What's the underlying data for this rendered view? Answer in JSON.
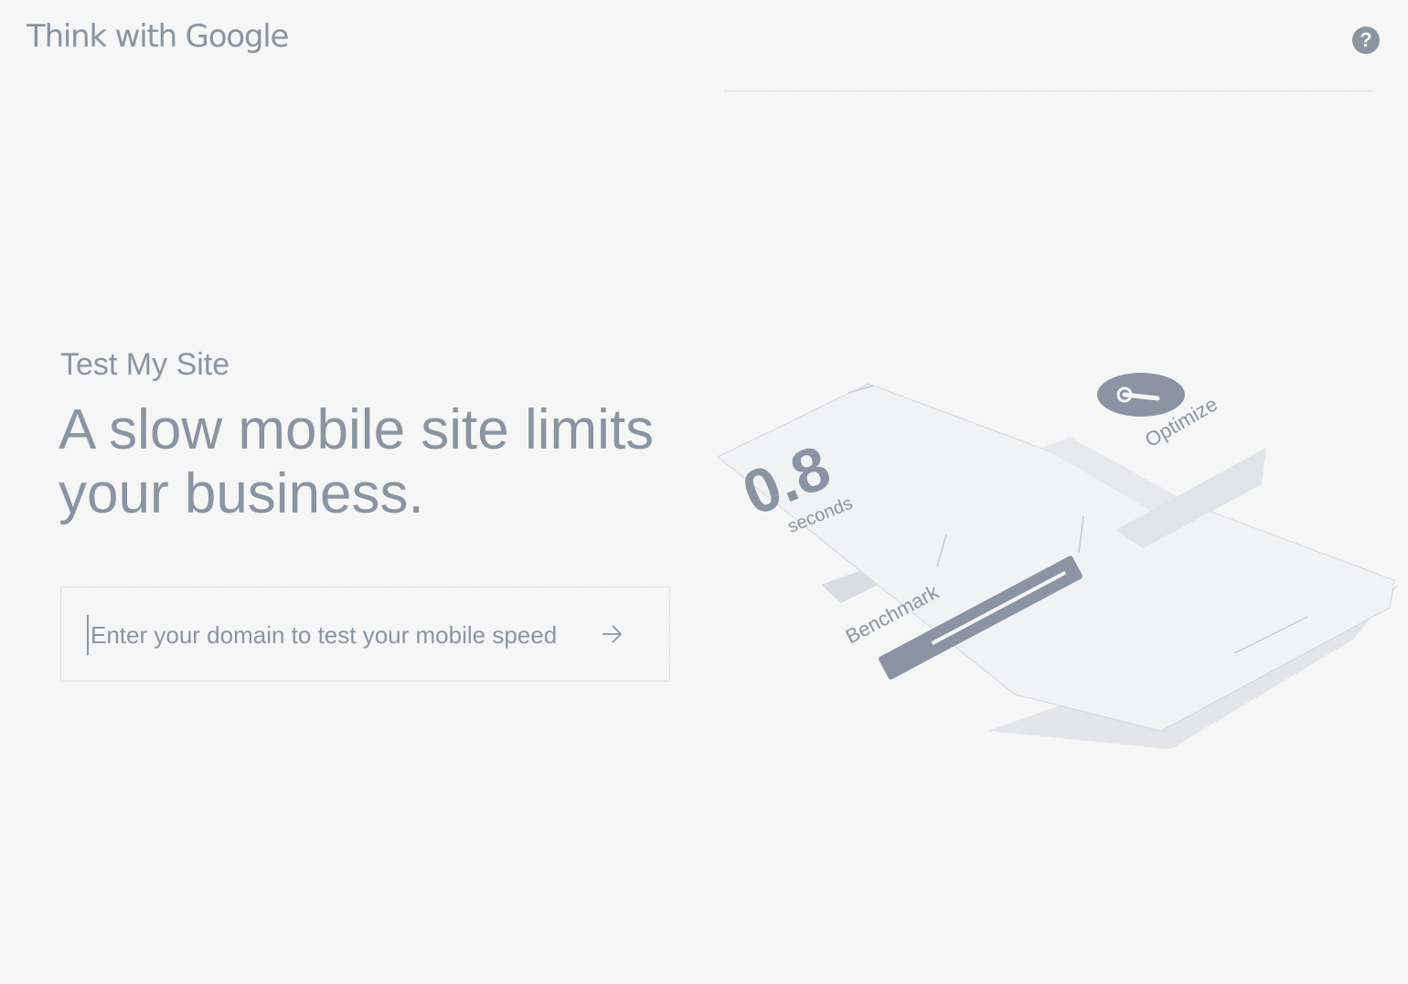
{
  "header": {
    "logo_text": "Think with Google",
    "help_icon": "question-circle-icon",
    "help_glyph": "?"
  },
  "hero": {
    "eyebrow": "Test My Site",
    "headline": "A slow mobile site limits your business."
  },
  "search": {
    "placeholder": "Enter your domain to test your mobile speed",
    "value": "",
    "submit_icon": "arrow-right-icon"
  },
  "illustration": {
    "speed_value": "0.8",
    "speed_unit": "seconds",
    "benchmark_label": "Benchmark",
    "optimize_label": "Optimize",
    "optimize_icon": "wrench-icon"
  },
  "colors": {
    "background": "#f6f6f6",
    "text": "#8b94a3",
    "rule": "#c6cad2"
  }
}
